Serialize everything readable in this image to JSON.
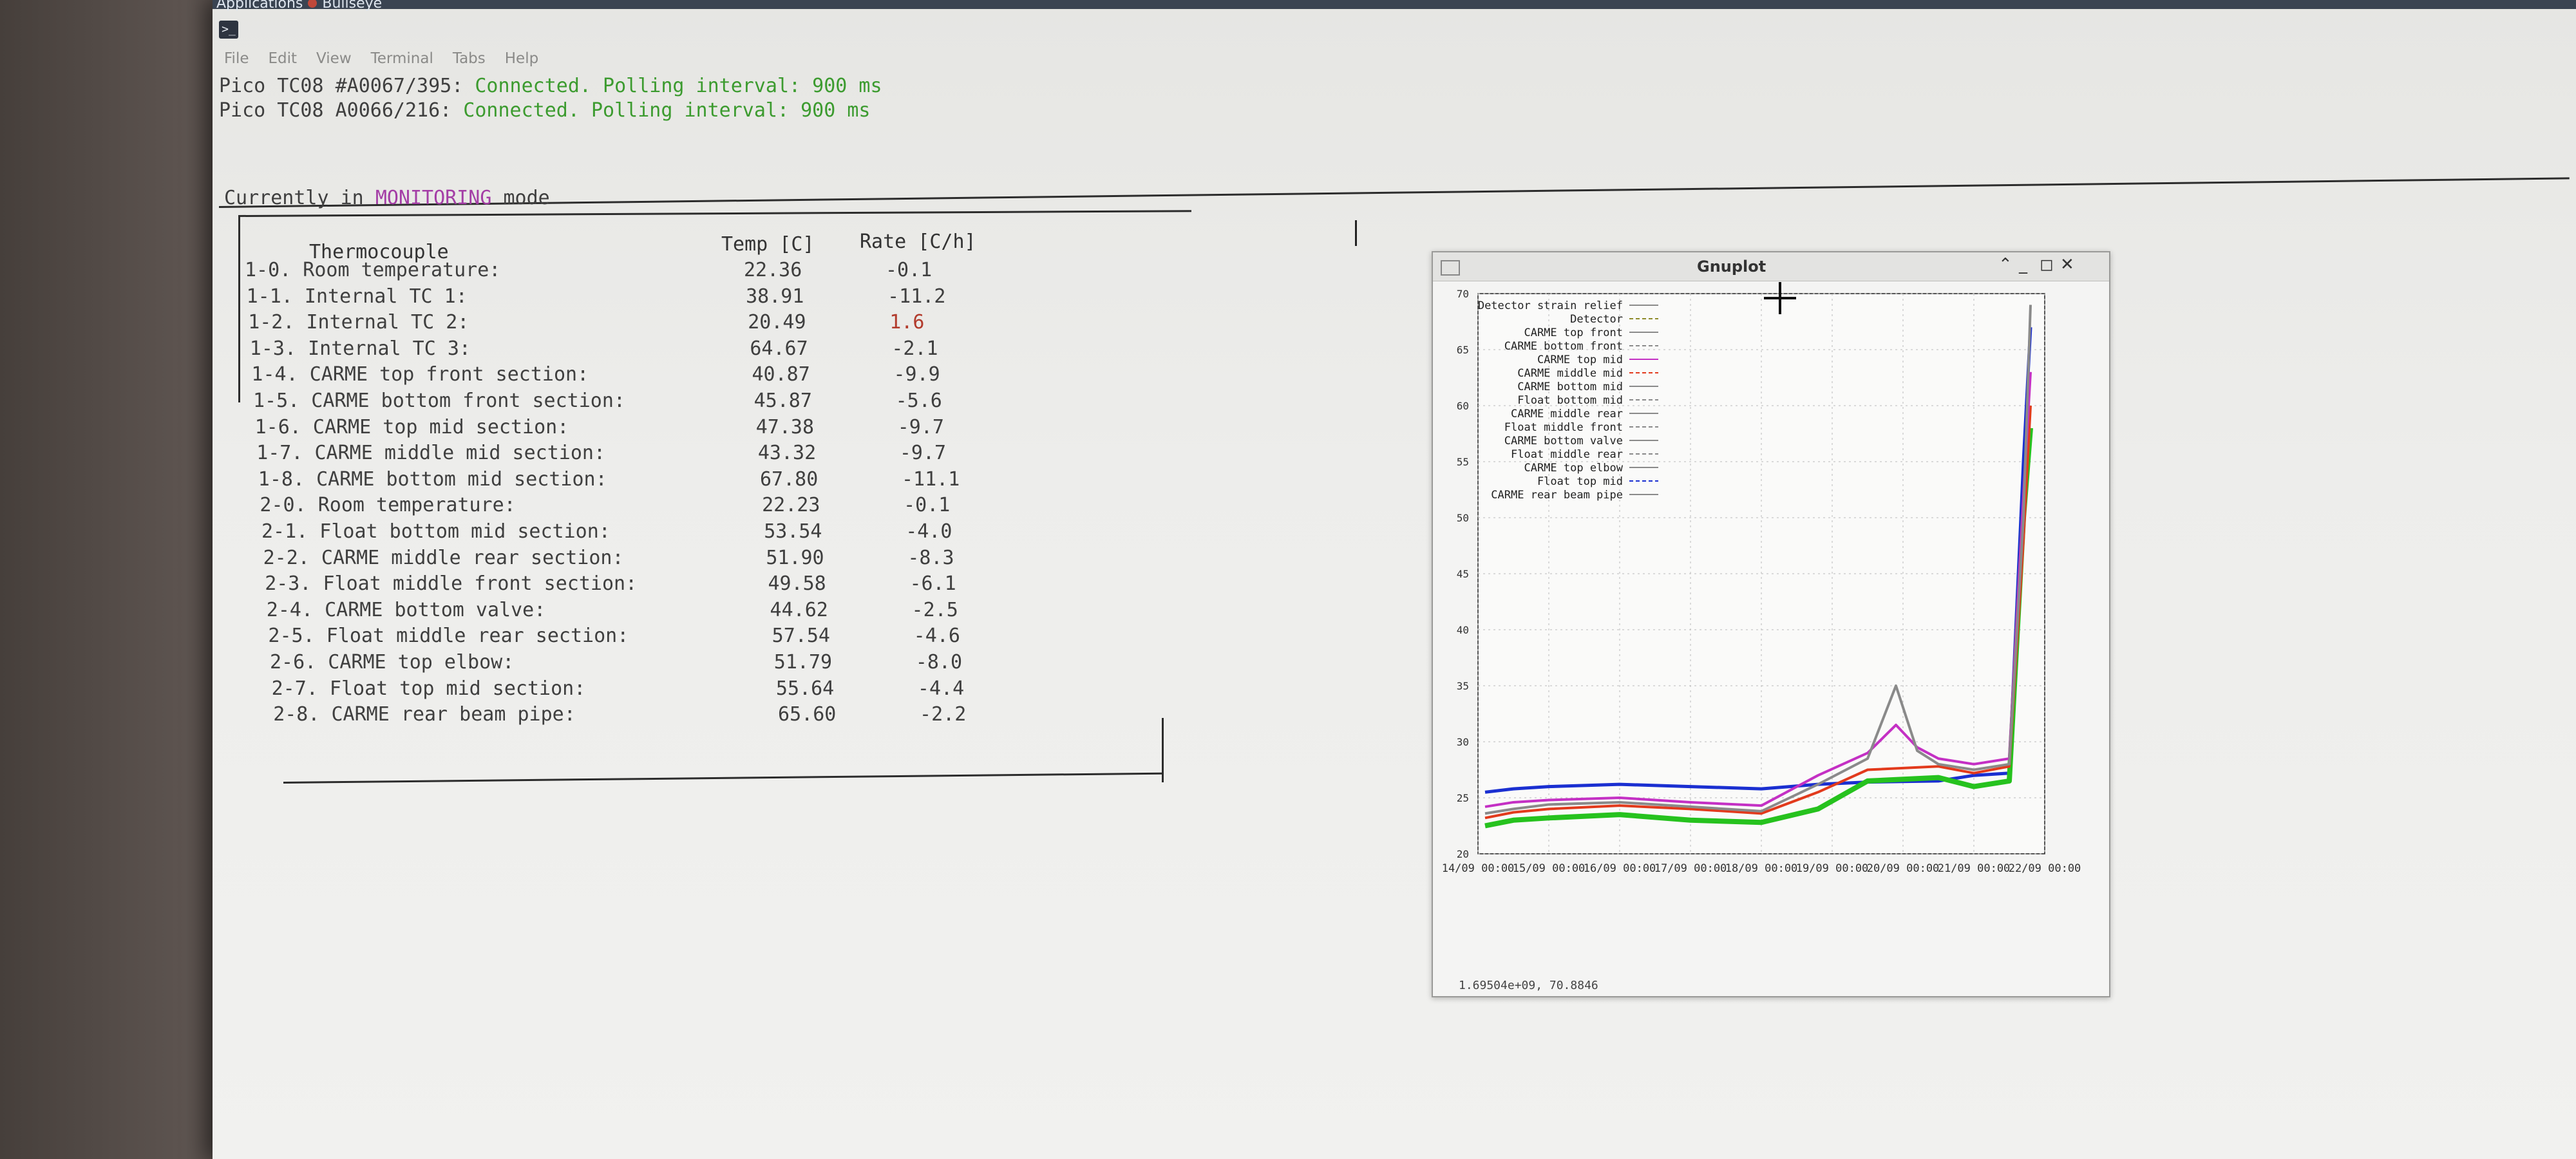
{
  "desktop": {
    "apps_label": "Applications",
    "second_label": "Bullseye"
  },
  "menu": [
    "File",
    "Edit",
    "View",
    "Terminal",
    "Tabs",
    "Help"
  ],
  "status_lines": [
    {
      "prefix": "Pico TC08 #A0067/395:",
      "text": "Connected. Polling interval: 900 ms"
    },
    {
      "prefix": "Pico TC08 A0066/216:",
      "text": "Connected. Polling interval: 900 ms"
    }
  ],
  "mode": {
    "prefix": "Currently in",
    "mode": "MONITORING",
    "suffix": "mode"
  },
  "table": {
    "headers": {
      "name": "Thermocouple",
      "temp": "Temp [C]",
      "rate": "Rate [C/h]"
    },
    "rows": [
      {
        "name": "1-0. Room temperature:",
        "temp": "22.36",
        "rate": "-0.1"
      },
      {
        "name": "1-1. Internal TC 1:",
        "temp": "38.91",
        "rate": "-11.2"
      },
      {
        "name": "1-2. Internal TC 2:",
        "temp": "20.49",
        "rate": "1.6"
      },
      {
        "name": "1-3. Internal TC 3:",
        "temp": "64.67",
        "rate": "-2.1"
      },
      {
        "name": "1-4. CARME top front section:",
        "temp": "40.87",
        "rate": "-9.9"
      },
      {
        "name": "1-5. CARME bottom front section:",
        "temp": "45.87",
        "rate": "-5.6"
      },
      {
        "name": "1-6. CARME top mid section:",
        "temp": "47.38",
        "rate": "-9.7"
      },
      {
        "name": "1-7. CARME middle mid section:",
        "temp": "43.32",
        "rate": "-9.7"
      },
      {
        "name": "1-8. CARME bottom mid section:",
        "temp": "67.80",
        "rate": "-11.1"
      },
      {
        "name": "2-0. Room temperature:",
        "temp": "22.23",
        "rate": "-0.1"
      },
      {
        "name": "2-1. Float bottom mid section:",
        "temp": "53.54",
        "rate": "-4.0"
      },
      {
        "name": "2-2. CARME middle rear section:",
        "temp": "51.90",
        "rate": "-8.3"
      },
      {
        "name": "2-3. Float middle front section:",
        "temp": "49.58",
        "rate": "-6.1"
      },
      {
        "name": "2-4. CARME bottom valve:",
        "temp": "44.62",
        "rate": "-2.5"
      },
      {
        "name": "2-5. Float middle rear section:",
        "temp": "57.54",
        "rate": "-4.6"
      },
      {
        "name": "2-6. CARME top elbow:",
        "temp": "51.79",
        "rate": "-8.0"
      },
      {
        "name": "2-7. Float top mid section:",
        "temp": "55.64",
        "rate": "-4.4"
      },
      {
        "name": "2-8. CARME rear beam pipe:",
        "temp": "65.60",
        "rate": "-2.2"
      }
    ]
  },
  "gnuplot": {
    "title": "Gnuplot",
    "status": "1.69504e+09,  70.8846",
    "chart_data": {
      "type": "line",
      "ylim": [
        20,
        70
      ],
      "y_ticks": [
        "20",
        "25",
        "30",
        "35",
        "40",
        "45",
        "50",
        "55",
        "60",
        "65",
        "70"
      ],
      "x_ticks": [
        "14/09 00:00",
        "15/09 00:00",
        "16/09 00:00",
        "17/09 00:00",
        "18/09 00:00",
        "19/09 00:00",
        "20/09 00:00",
        "21/09 00:00",
        "22/09 00:00"
      ],
      "grid": true,
      "legend_position": "top-left",
      "legend": [
        "Detector strain relief",
        "Detector",
        "CARME top front",
        "CARME bottom front",
        "CARME top mid",
        "CARME middle mid",
        "CARME bottom mid",
        "Float bottom mid",
        "CARME middle rear",
        "Float middle front",
        "CARME bottom valve",
        "Float middle rear",
        "CARME top elbow",
        "Float top mid",
        "CARME rear beam pipe"
      ],
      "colors": {
        "blue": "#1a2fd1",
        "green": "#26c21e",
        "red": "#e23a1c",
        "magenta": "#c430c4",
        "gray": "#8a8a8a",
        "olive": "#8e8a2a"
      },
      "series_approx": [
        {
          "name": "Detector strain relief",
          "color": "blue",
          "x": [
            14.1,
            14.5,
            15.0,
            16.0,
            17.0,
            18.0,
            18.8,
            19.5,
            20.5,
            21.0,
            21.5,
            21.7,
            21.8
          ],
          "y": [
            25.5,
            25.8,
            26.0,
            26.2,
            26.0,
            25.8,
            26.2,
            26.4,
            26.5,
            27.0,
            27.2,
            55.0,
            67.0
          ]
        },
        {
          "name": "Detector",
          "color": "green",
          "x": [
            14.1,
            14.5,
            15.0,
            16.0,
            17.0,
            18.0,
            18.8,
            19.5,
            20.5,
            21.0,
            21.5,
            21.7,
            21.8
          ],
          "y": [
            22.5,
            23.0,
            23.2,
            23.5,
            23.0,
            22.8,
            24.0,
            26.5,
            26.8,
            26.0,
            26.5,
            50.0,
            58.0
          ]
        },
        {
          "name": "CARME top front",
          "color": "red",
          "x": [
            14.1,
            14.5,
            15.0,
            16.0,
            17.0,
            18.0,
            18.8,
            19.5,
            20.5,
            21.0,
            21.5,
            21.7,
            21.8
          ],
          "y": [
            23.2,
            23.7,
            24.0,
            24.3,
            24.0,
            23.6,
            25.5,
            27.5,
            27.8,
            27.2,
            27.8,
            48.0,
            60.0
          ]
        },
        {
          "name": "CARME top mid",
          "color": "magenta",
          "x": [
            14.1,
            14.5,
            15.0,
            16.0,
            17.0,
            18.0,
            18.8,
            19.5,
            19.9,
            20.2,
            20.5,
            21.0,
            21.5,
            21.7,
            21.8
          ],
          "y": [
            24.2,
            24.6,
            24.8,
            25.0,
            24.6,
            24.3,
            27.0,
            29.0,
            31.5,
            29.5,
            28.5,
            28.0,
            28.5,
            52.0,
            63.0
          ]
        },
        {
          "name": "CARME bottom mid",
          "color": "gray",
          "x": [
            14.1,
            14.5,
            15.0,
            16.0,
            17.0,
            18.0,
            18.8,
            19.5,
            19.9,
            20.2,
            20.5,
            21.0,
            21.5,
            21.7,
            21.8
          ],
          "y": [
            23.6,
            24.0,
            24.4,
            24.6,
            24.2,
            23.8,
            26.2,
            28.5,
            35.0,
            29.2,
            28.0,
            27.5,
            28.0,
            50.0,
            69.0
          ]
        }
      ]
    }
  }
}
